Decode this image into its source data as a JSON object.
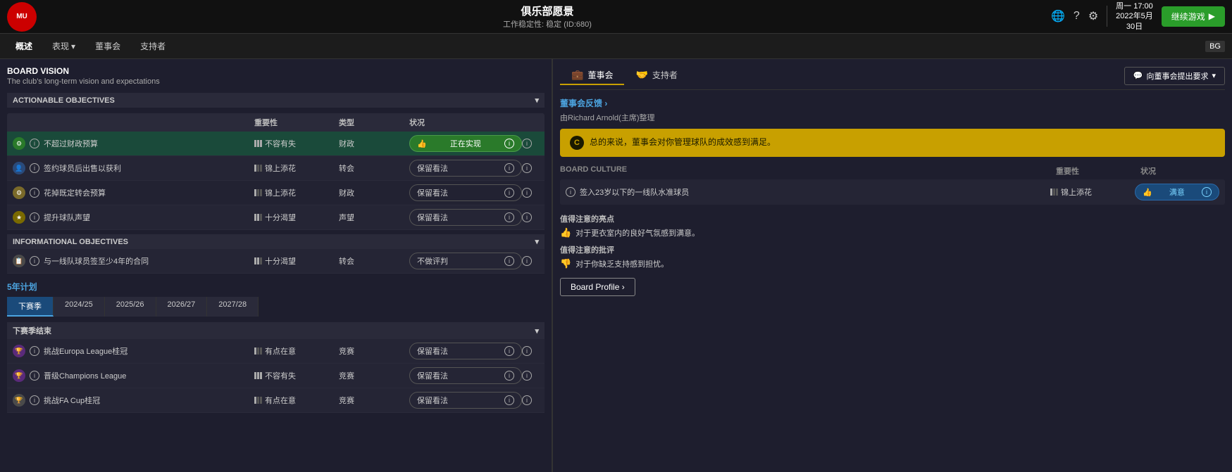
{
  "topbar": {
    "logo": "MU",
    "title": "俱乐部愿景",
    "subtitle": "工作稳定性: 稳定 (ID:680)",
    "time": "周一 17:00",
    "date": "2022年5月",
    "day": "30日",
    "continue_label": "继续游戏",
    "icons": [
      "🌐",
      "?",
      "⚙"
    ]
  },
  "nav": {
    "items": [
      {
        "label": "概述",
        "active": true
      },
      {
        "label": "表现",
        "dropdown": true
      },
      {
        "label": "董事会"
      },
      {
        "label": "支持者"
      }
    ],
    "corner": "BG"
  },
  "board_vision": {
    "title": "BOARD VISION",
    "subtitle": "The club's long-term vision and expectations"
  },
  "actionable_objectives": {
    "header": "ACTIONABLE OBJECTIVES",
    "columns": [
      "",
      "重要性",
      "类型",
      "状况",
      ""
    ],
    "rows": [
      {
        "icon_type": "green",
        "icon_char": "⚙",
        "label": "不超过财政预算",
        "importance": "不容有失",
        "importance_level": 3,
        "type": "财政",
        "status": "正在实现",
        "status_type": "green-active",
        "has_thumb": true
      },
      {
        "icon_type": "blue",
        "icon_char": "👤",
        "label": "签约球员后出售以获利",
        "importance": "锦上添花",
        "importance_level": 1,
        "type": "转会",
        "status": "保留看法",
        "status_type": "outline"
      },
      {
        "icon_type": "yellow",
        "icon_char": "⚙",
        "label": "花掉既定转会预算",
        "importance": "锦上添花",
        "importance_level": 1,
        "type": "财政",
        "status": "保留看法",
        "status_type": "outline"
      },
      {
        "icon_type": "gold",
        "icon_char": "★",
        "label": "提升球队声望",
        "importance": "十分渴望",
        "importance_level": 2,
        "type": "声望",
        "status": "保留看法",
        "status_type": "outline"
      }
    ]
  },
  "informational_objectives": {
    "header": "INFORMATIONAL OBJECTIVES",
    "columns": [
      "",
      "类型",
      "状况",
      ""
    ],
    "rows": [
      {
        "icon_type": "grey",
        "icon_char": "📋",
        "label": "与一线队球员签至少4年的合同",
        "importance": "十分渴望",
        "importance_level": 2,
        "type": "转会",
        "status": "不做评判",
        "status_type": "outline"
      }
    ]
  },
  "five_year": {
    "title": "5年计划",
    "tabs": [
      "下赛季",
      "2024/25",
      "2025/26",
      "2026/27",
      "2027/28"
    ],
    "active_tab": 0,
    "season_label": "下赛季结束",
    "columns": [
      "",
      "重要性",
      "类型",
      "状况",
      ""
    ],
    "rows": [
      {
        "icon_type": "purple",
        "icon_char": "🏆",
        "label": "挑战Europa League桂冠",
        "importance": "有点在意",
        "importance_level": 1,
        "type": "竞赛",
        "status": "保留看法",
        "status_type": "outline"
      },
      {
        "icon_type": "purple",
        "icon_char": "🏆",
        "label": "晋级Champions League",
        "importance": "不容有失",
        "importance_level": 3,
        "type": "竞赛",
        "status": "保留看法",
        "status_type": "outline"
      },
      {
        "icon_type": "grey",
        "icon_char": "🏆",
        "label": "挑战FA Cup桂冠",
        "importance": "有点在意",
        "importance_level": 1,
        "type": "竞赛",
        "status": "保留看法",
        "status_type": "outline"
      }
    ]
  },
  "right_panel": {
    "tabs": [
      {
        "label": "董事会",
        "icon": "💼",
        "active": true
      },
      {
        "label": "支持者",
        "icon": "🤝"
      }
    ],
    "demand_btn": "向董事会提出要求",
    "board_feedback": {
      "title": "董事会反馈 ›",
      "by": "由Richard Arnold(主席)整理",
      "message": "总的来说，董事会对你管理球队的成效感到满足。"
    },
    "board_culture": {
      "title": "BOARD CULTURE",
      "col_importance": "重要性",
      "col_status": "状况",
      "rows": [
        {
          "label": "签入23岁以下的一线队水准球员",
          "importance": "锦上添花",
          "importance_level": 1,
          "status": "满意",
          "status_type": "blue-active"
        }
      ]
    },
    "highlights": {
      "positive_title": "值得注意的亮点",
      "positive": "对于更衣室内的良好气氛感到满意。",
      "negative_title": "值得注意的批评",
      "negative": "对于你缺乏支持感到担忧。"
    },
    "board_profile_btn": "Board Profile ›"
  }
}
